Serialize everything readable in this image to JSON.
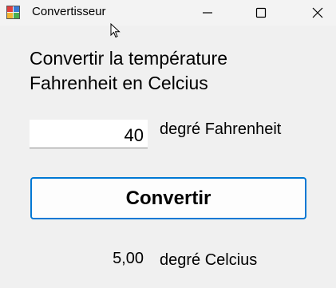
{
  "window": {
    "title": "Convertisseur"
  },
  "icons": {
    "app": "app-icon",
    "minimize": "minimize-icon",
    "maximize": "maximize-icon",
    "close": "close-icon",
    "cursor": "mouse-cursor-icon"
  },
  "heading": {
    "line1": "Convertir la température",
    "line2": "Fahrenheit en Celcius"
  },
  "input": {
    "value": "40",
    "unit_label": "degré Fahrenheit"
  },
  "convert_button": {
    "label": "Convertir"
  },
  "result": {
    "value": "5,00",
    "unit_label": "degré Celcius"
  },
  "colors": {
    "window_bg": "#f0f0f0",
    "button_border": "#0078d4"
  }
}
